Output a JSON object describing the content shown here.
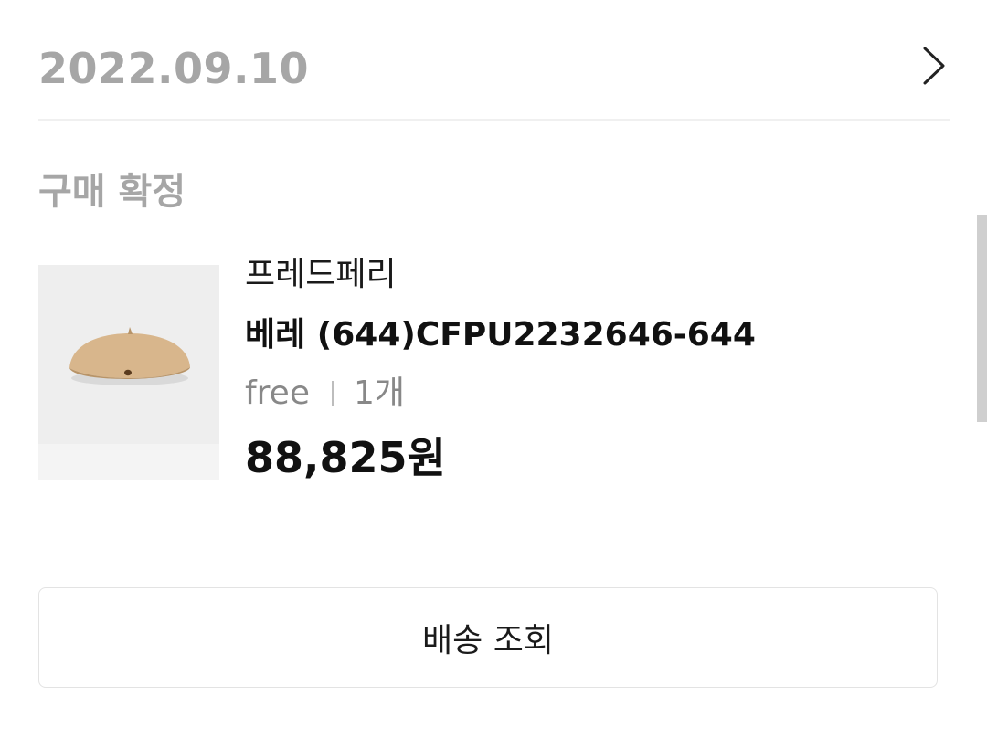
{
  "order": {
    "date": "2022.09.10",
    "status": "구매 확정"
  },
  "product": {
    "brand": "프레드페리",
    "name": "베레 (644)CFPU2232646-644",
    "size": "free",
    "quantity": "1개",
    "price": "88,825원",
    "thumbnail_icon": "beret-image"
  },
  "actions": {
    "track_delivery": "배송 조회"
  },
  "icons": {
    "detail": "chevron-right-icon"
  },
  "colors": {
    "muted_text": "#a6a6a6",
    "beret": "#d7b58c"
  }
}
